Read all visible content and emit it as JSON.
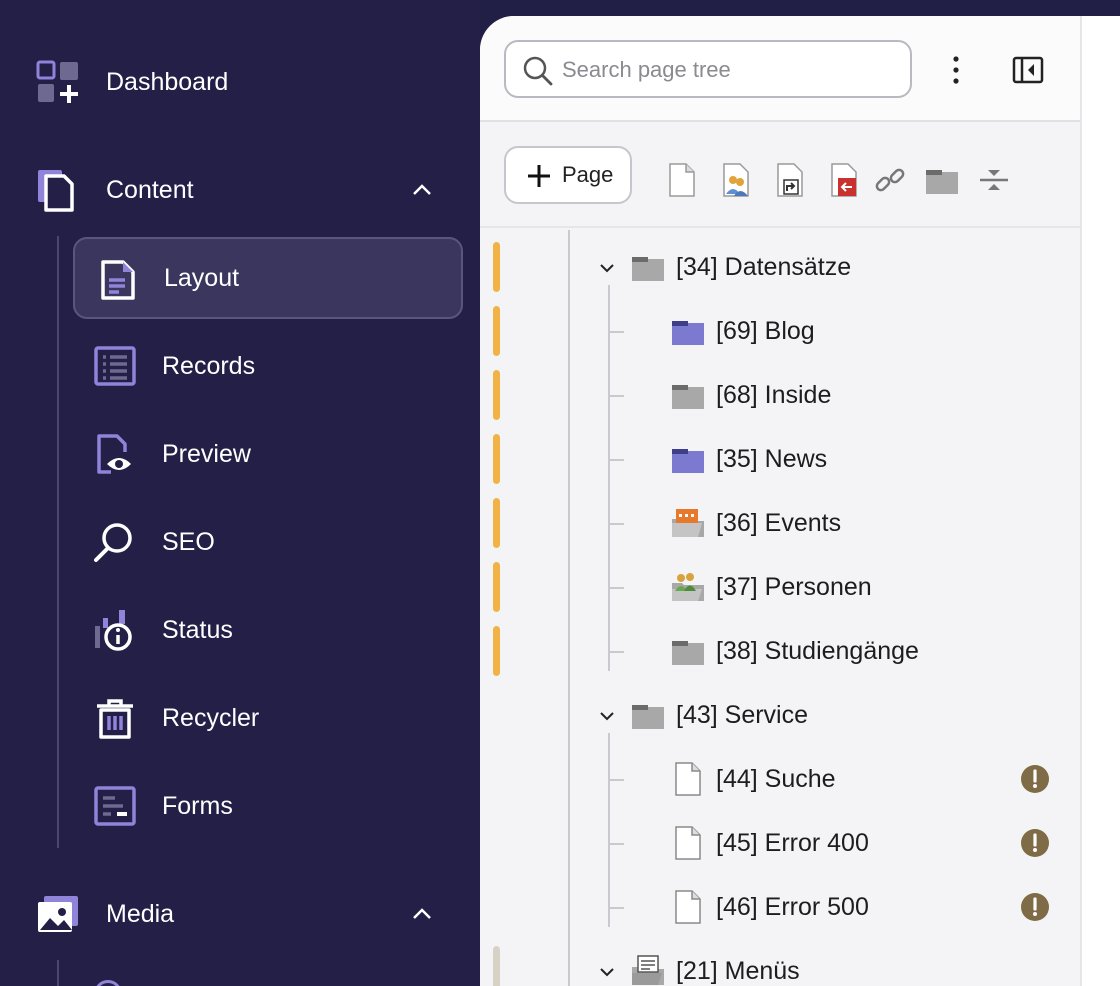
{
  "sidebar": {
    "dashboard": {
      "label": "Dashboard",
      "icon": "dashboard-icon"
    },
    "content": {
      "label": "Content",
      "expanded": true,
      "items": [
        {
          "label": "Layout",
          "icon": "layout-page-icon",
          "active": true
        },
        {
          "label": "Records",
          "icon": "records-list-icon"
        },
        {
          "label": "Preview",
          "icon": "preview-eye-icon"
        },
        {
          "label": "SEO",
          "icon": "seo-magnifier-icon"
        },
        {
          "label": "Status",
          "icon": "status-info-icon"
        },
        {
          "label": "Recycler",
          "icon": "recycler-trash-icon"
        },
        {
          "label": "Forms",
          "icon": "forms-icon"
        }
      ]
    },
    "media": {
      "label": "Media",
      "expanded": true,
      "icon": "media-image-icon"
    }
  },
  "pagetree": {
    "search_placeholder": "Search page tree",
    "add_page_label": "Page",
    "toolbar_icons": [
      "page-doktype-icon",
      "backend-user-section-icon",
      "shortcut-icon",
      "mountpoint-icon",
      "link-icon",
      "folder-icon",
      "spacer-icon"
    ],
    "nodes": [
      {
        "label": "[34] Datensätze",
        "icon": "folder-grey-icon",
        "expanded": true
      },
      {
        "label": "[69] Blog",
        "icon": "folder-blue-icon"
      },
      {
        "label": "[68] Inside",
        "icon": "folder-grey-icon"
      },
      {
        "label": "[35] News",
        "icon": "folder-blue-icon"
      },
      {
        "label": "[36] Events",
        "icon": "folder-calendar-icon"
      },
      {
        "label": "[37] Personen",
        "icon": "folder-people-icon"
      },
      {
        "label": "[38] Studiengänge",
        "icon": "folder-grey-icon"
      },
      {
        "label": "[43] Service",
        "icon": "folder-grey-icon",
        "expanded": true
      },
      {
        "label": "[44] Suche",
        "icon": "page-icon",
        "warning": true
      },
      {
        "label": "[45] Error 400",
        "icon": "page-icon",
        "warning": true
      },
      {
        "label": "[46] Error 500",
        "icon": "page-icon",
        "warning": true
      },
      {
        "label": "[21] Menüs",
        "icon": "folder-menu-icon",
        "expanded": true
      }
    ]
  },
  "colors": {
    "sidebar_bg": "#241f47",
    "accent_purple": "#8f84d9",
    "stage_indicator": "#f2b346",
    "warning_badge": "#7f6b45"
  }
}
